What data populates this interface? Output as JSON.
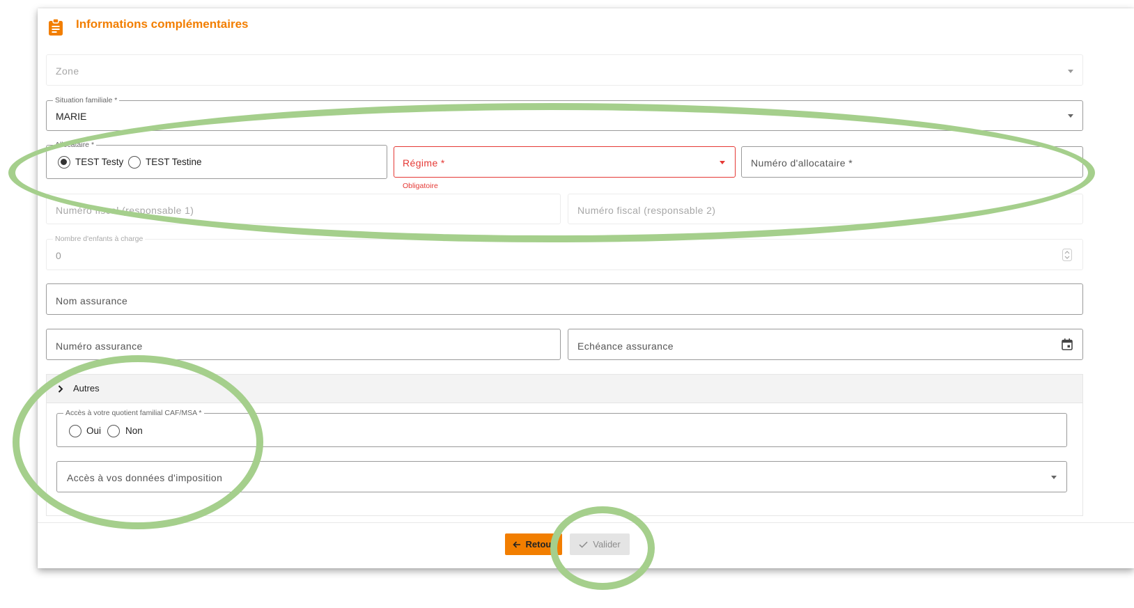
{
  "colors": {
    "accent": "#f27e00",
    "error": "#e53935",
    "annotation": "#a5cf8c"
  },
  "section": {
    "title": "Informations complémentaires",
    "icon": "clipboard-icon"
  },
  "fields": {
    "zone": {
      "label": "Zone"
    },
    "situation": {
      "label": "Situation familiale *",
      "value": "MARIE"
    },
    "allocataire": {
      "label": "Allocataire *",
      "options": [
        "TEST Testy",
        "TEST Testine"
      ],
      "selected": "TEST Testy"
    },
    "regime": {
      "label": "Régime *",
      "error": "Obligatoire"
    },
    "numero_allocataire": {
      "label": "Numéro d'allocataire *"
    },
    "fiscal1": {
      "label": "Numéro fiscal (responsable 1)"
    },
    "fiscal2": {
      "label": "Numéro fiscal (responsable 2)"
    },
    "enfants": {
      "label": "Nombre d'enfants à charge",
      "value": "0"
    },
    "nom_assurance": {
      "label": "Nom assurance"
    },
    "numero_assurance": {
      "label": "Numéro assurance"
    },
    "echeance": {
      "label": "Echéance assurance",
      "icon": "calendar-icon"
    }
  },
  "autres": {
    "title": "Autres",
    "quotient": {
      "label": "Accès à votre quotient familial CAF/MSA *",
      "options": [
        "Oui",
        "Non"
      ]
    },
    "imposition": {
      "label": "Accès à vos données d'imposition"
    }
  },
  "buttons": {
    "retour": "Retour",
    "valider": "Valider"
  }
}
